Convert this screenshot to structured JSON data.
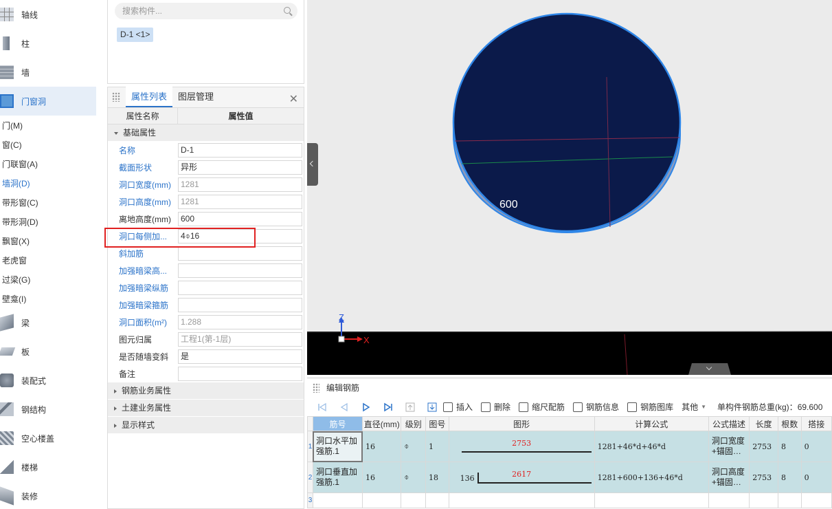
{
  "left_nav": {
    "top_categories": [
      {
        "label": "轴线",
        "icon": "grid-axis-icon"
      },
      {
        "label": "柱",
        "icon": "column-icon"
      },
      {
        "label": "墙",
        "icon": "wall-icon"
      },
      {
        "label": "门窗洞",
        "icon": "door-window-icon"
      }
    ],
    "sub_items": [
      "门(M)",
      "窗(C)",
      "门联窗(A)",
      "墙洞(D)",
      "带形窗(C)",
      "带形洞(D)",
      "飘窗(X)",
      "老虎窗",
      "过梁(G)",
      "壁龛(I)"
    ],
    "selected_sub": "墙洞(D)",
    "bottom_categories": [
      {
        "label": "梁",
        "icon": "beam-icon"
      },
      {
        "label": "板",
        "icon": "slab-icon"
      },
      {
        "label": "装配式",
        "icon": "prefab-icon"
      },
      {
        "label": "钢结构",
        "icon": "steel-structure-icon"
      },
      {
        "label": "空心楼盖",
        "icon": "hollow-slab-icon"
      },
      {
        "label": "楼梯",
        "icon": "stair-icon"
      },
      {
        "label": "装修",
        "icon": "decoration-icon"
      }
    ]
  },
  "component_panel": {
    "search_placeholder": "搜索构件...",
    "selected_component": "D-1 <1>"
  },
  "properties": {
    "tabs": [
      "属性列表",
      "图层管理"
    ],
    "active_tab": "属性列表",
    "header": {
      "name": "属性名称",
      "value": "属性值"
    },
    "basic_group": "基础属性",
    "rows": [
      {
        "name": "名称",
        "value": "D-1",
        "link": true,
        "dim": false
      },
      {
        "name": "截面形状",
        "value": "异形",
        "link": true,
        "dim": false
      },
      {
        "name": "洞口宽度(mm)",
        "value": "1281",
        "link": true,
        "dim": true
      },
      {
        "name": "洞口高度(mm)",
        "value": "1281",
        "link": true,
        "dim": true
      },
      {
        "name": "离地高度(mm)",
        "value": "600",
        "link": false,
        "dim": false
      },
      {
        "name": "洞口每侧加...",
        "value": "4⌽16",
        "link": true,
        "dim": false
      },
      {
        "name": "斜加筋",
        "value": "",
        "link": true,
        "dim": false
      },
      {
        "name": "加强暗梁高...",
        "value": "",
        "link": true,
        "dim": false
      },
      {
        "name": "加强暗梁纵筋",
        "value": "",
        "link": true,
        "dim": false
      },
      {
        "name": "加强暗梁箍筋",
        "value": "",
        "link": true,
        "dim": false
      },
      {
        "name": "洞口面积(m²)",
        "value": "1.288",
        "link": true,
        "dim": true
      },
      {
        "name": "图元归属",
        "value": "工程1(第-1层)",
        "link": false,
        "dim": true
      },
      {
        "name": "是否随墙变斜",
        "value": "是",
        "link": false,
        "dim": false
      },
      {
        "name": "备注",
        "value": "",
        "link": false,
        "dim": false
      }
    ],
    "collapsed_groups": [
      "钢筋业务属性",
      "土建业务属性",
      "显示样式"
    ]
  },
  "viewport": {
    "partial_label": "600",
    "axis_z": "Z",
    "axis_x": "X",
    "disc_color": "#0b1a4a",
    "edge_color": "#2e86e8"
  },
  "rebar_editor": {
    "title": "编辑钢筋",
    "toolbar": {
      "insert": "插入",
      "delete": "删除",
      "scale": "缩尺配筋",
      "info": "钢筋信息",
      "library": "钢筋图库",
      "other": "其他",
      "total_label": "单构件钢筋总重(kg)：",
      "total_value": "69.600"
    },
    "columns": [
      "筋号",
      "直径(mm)",
      "级别",
      "图号",
      "图形",
      "计算公式",
      "公式描述",
      "长度",
      "根数",
      "搭接"
    ],
    "rows": [
      {
        "idx": "1",
        "name": "洞口水平加强筋.1",
        "diameter": "16",
        "grade": "⌽",
        "fig": "1",
        "shape_len": "2753",
        "hook": "",
        "formula": "1281+46*d+46*d",
        "desc": "洞口宽度+锚固…",
        "length": "2753",
        "count": "8",
        "lap": "0"
      },
      {
        "idx": "2",
        "name": "洞口垂直加强筋.1",
        "diameter": "16",
        "grade": "⌽",
        "fig": "18",
        "shape_len": "2617",
        "hook": "136",
        "formula": "1281+600+136+46*d",
        "desc": "洞口高度+锚固…",
        "length": "2753",
        "count": "8",
        "lap": "0"
      },
      {
        "idx": "3",
        "name": "",
        "diameter": "",
        "grade": "",
        "fig": "",
        "shape_len": "",
        "hook": "",
        "formula": "",
        "desc": "",
        "length": "",
        "count": "",
        "lap": ""
      }
    ]
  }
}
